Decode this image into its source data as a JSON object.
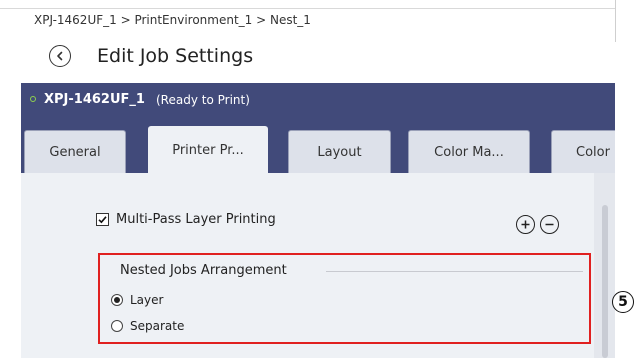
{
  "breadcrumb": "XPJ-1462UF_1 > PrintEnvironment_1 > Nest_1",
  "page_title": "Edit Job Settings",
  "status": {
    "printer_name": "XPJ-1462UF_1",
    "printer_status": "(Ready to Print)",
    "indicator_color": "#8fd14f"
  },
  "tabs": [
    {
      "label": "General",
      "active": false
    },
    {
      "label": "Printer Pr...",
      "active": true
    },
    {
      "label": "Layout",
      "active": false
    },
    {
      "label": "Color Ma...",
      "active": false
    },
    {
      "label": "Color",
      "active": false
    }
  ],
  "multipass": {
    "label": "Multi-Pass Layer Printing",
    "checked": true
  },
  "buttons": {
    "add_icon": "plus-circle-icon",
    "remove_icon": "minus-circle-icon"
  },
  "arrangement": {
    "title": "Nested Jobs Arrangement",
    "options": [
      {
        "label": "Layer",
        "selected": true
      },
      {
        "label": "Separate",
        "selected": false
      }
    ]
  },
  "callout": "5",
  "colors": {
    "header_bg": "#414a7a",
    "content_bg": "#eef1f5",
    "highlight_box": "#e02020"
  }
}
